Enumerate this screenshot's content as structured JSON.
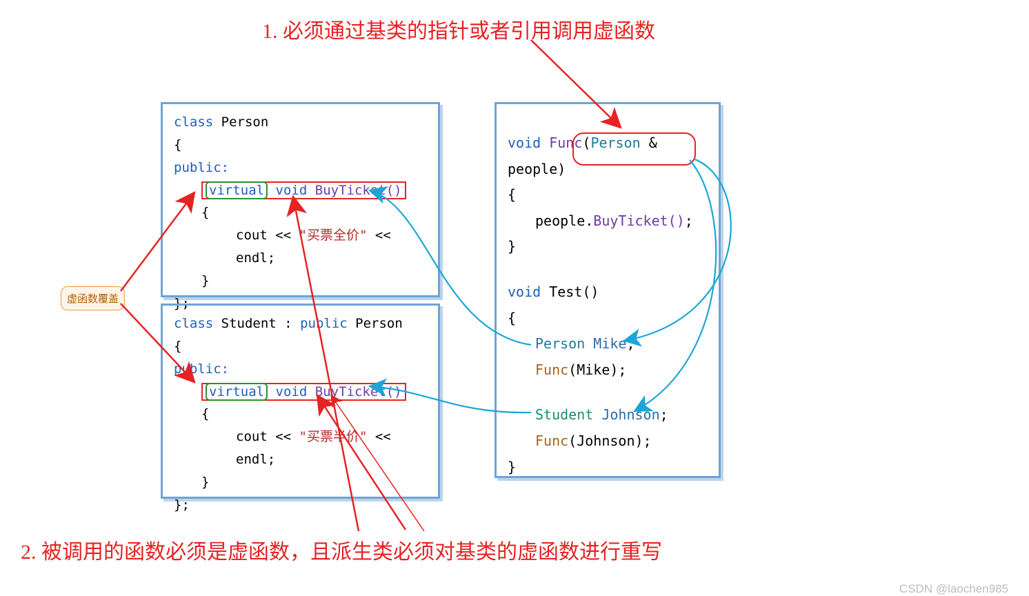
{
  "annotations": {
    "top": "1. 必须通过基类的指针或者引用调用虚函数",
    "bottom": "2. 被调用的函数必须是虚函数，且派生类必须对基类的虚函数进行重写",
    "badge": "虚函数覆盖",
    "watermark": "CSDN @laochen985"
  },
  "code": {
    "person": {
      "l1_class": "class",
      "l1_name": "Person",
      "l2": "{",
      "l3": "public:",
      "l4_virtual": "virtual",
      "l4_void": "void",
      "l4_fn": "BuyTicket()",
      "l5": "{",
      "l6_pre": "cout << ",
      "l6_str": "\"买票全价\"",
      "l6_post": " << endl;",
      "l7": "}",
      "l8": "};"
    },
    "student": {
      "l1_class": "class",
      "l1_name": "Student",
      "l1_mid": " : ",
      "l1_pub": "public",
      "l1_base": " Person",
      "l2": "{",
      "l3": "public:",
      "l4_virtual": "virtual",
      "l4_void": "void",
      "l4_fn": "BuyTicket()",
      "l5": "{",
      "l6_pre": "cout << ",
      "l6_str": "\"买票半价\"",
      "l6_post": " << endl;",
      "l7": "}",
      "l8": "};"
    },
    "right": {
      "f_void": "void",
      "f_fn": "Func",
      "f_open": "(",
      "f_cls": "Person",
      "f_amp": " & ",
      "f_arg": "people",
      "f_close": ")",
      "f_l2": "{",
      "f_l3_pre": "people.",
      "f_l3_call": "BuyTicket()",
      "f_l3_end": ";",
      "f_l4": "}",
      "t_void": "void",
      "t_fn": "Test()",
      "t_l2": "{",
      "t_p_cls": "Person",
      "t_p_var": " Mike",
      "t_p_end": ";",
      "t_fm": "Func",
      "t_fm_arg": "(Mike)",
      "t_fm_end": ";",
      "t_s_cls": "Student",
      "t_s_var": " Johnson",
      "t_s_end": ";",
      "t_fj": "Func",
      "t_fj_arg": "(Johnson)",
      "t_fj_end": ";",
      "t_l3": "}"
    }
  }
}
